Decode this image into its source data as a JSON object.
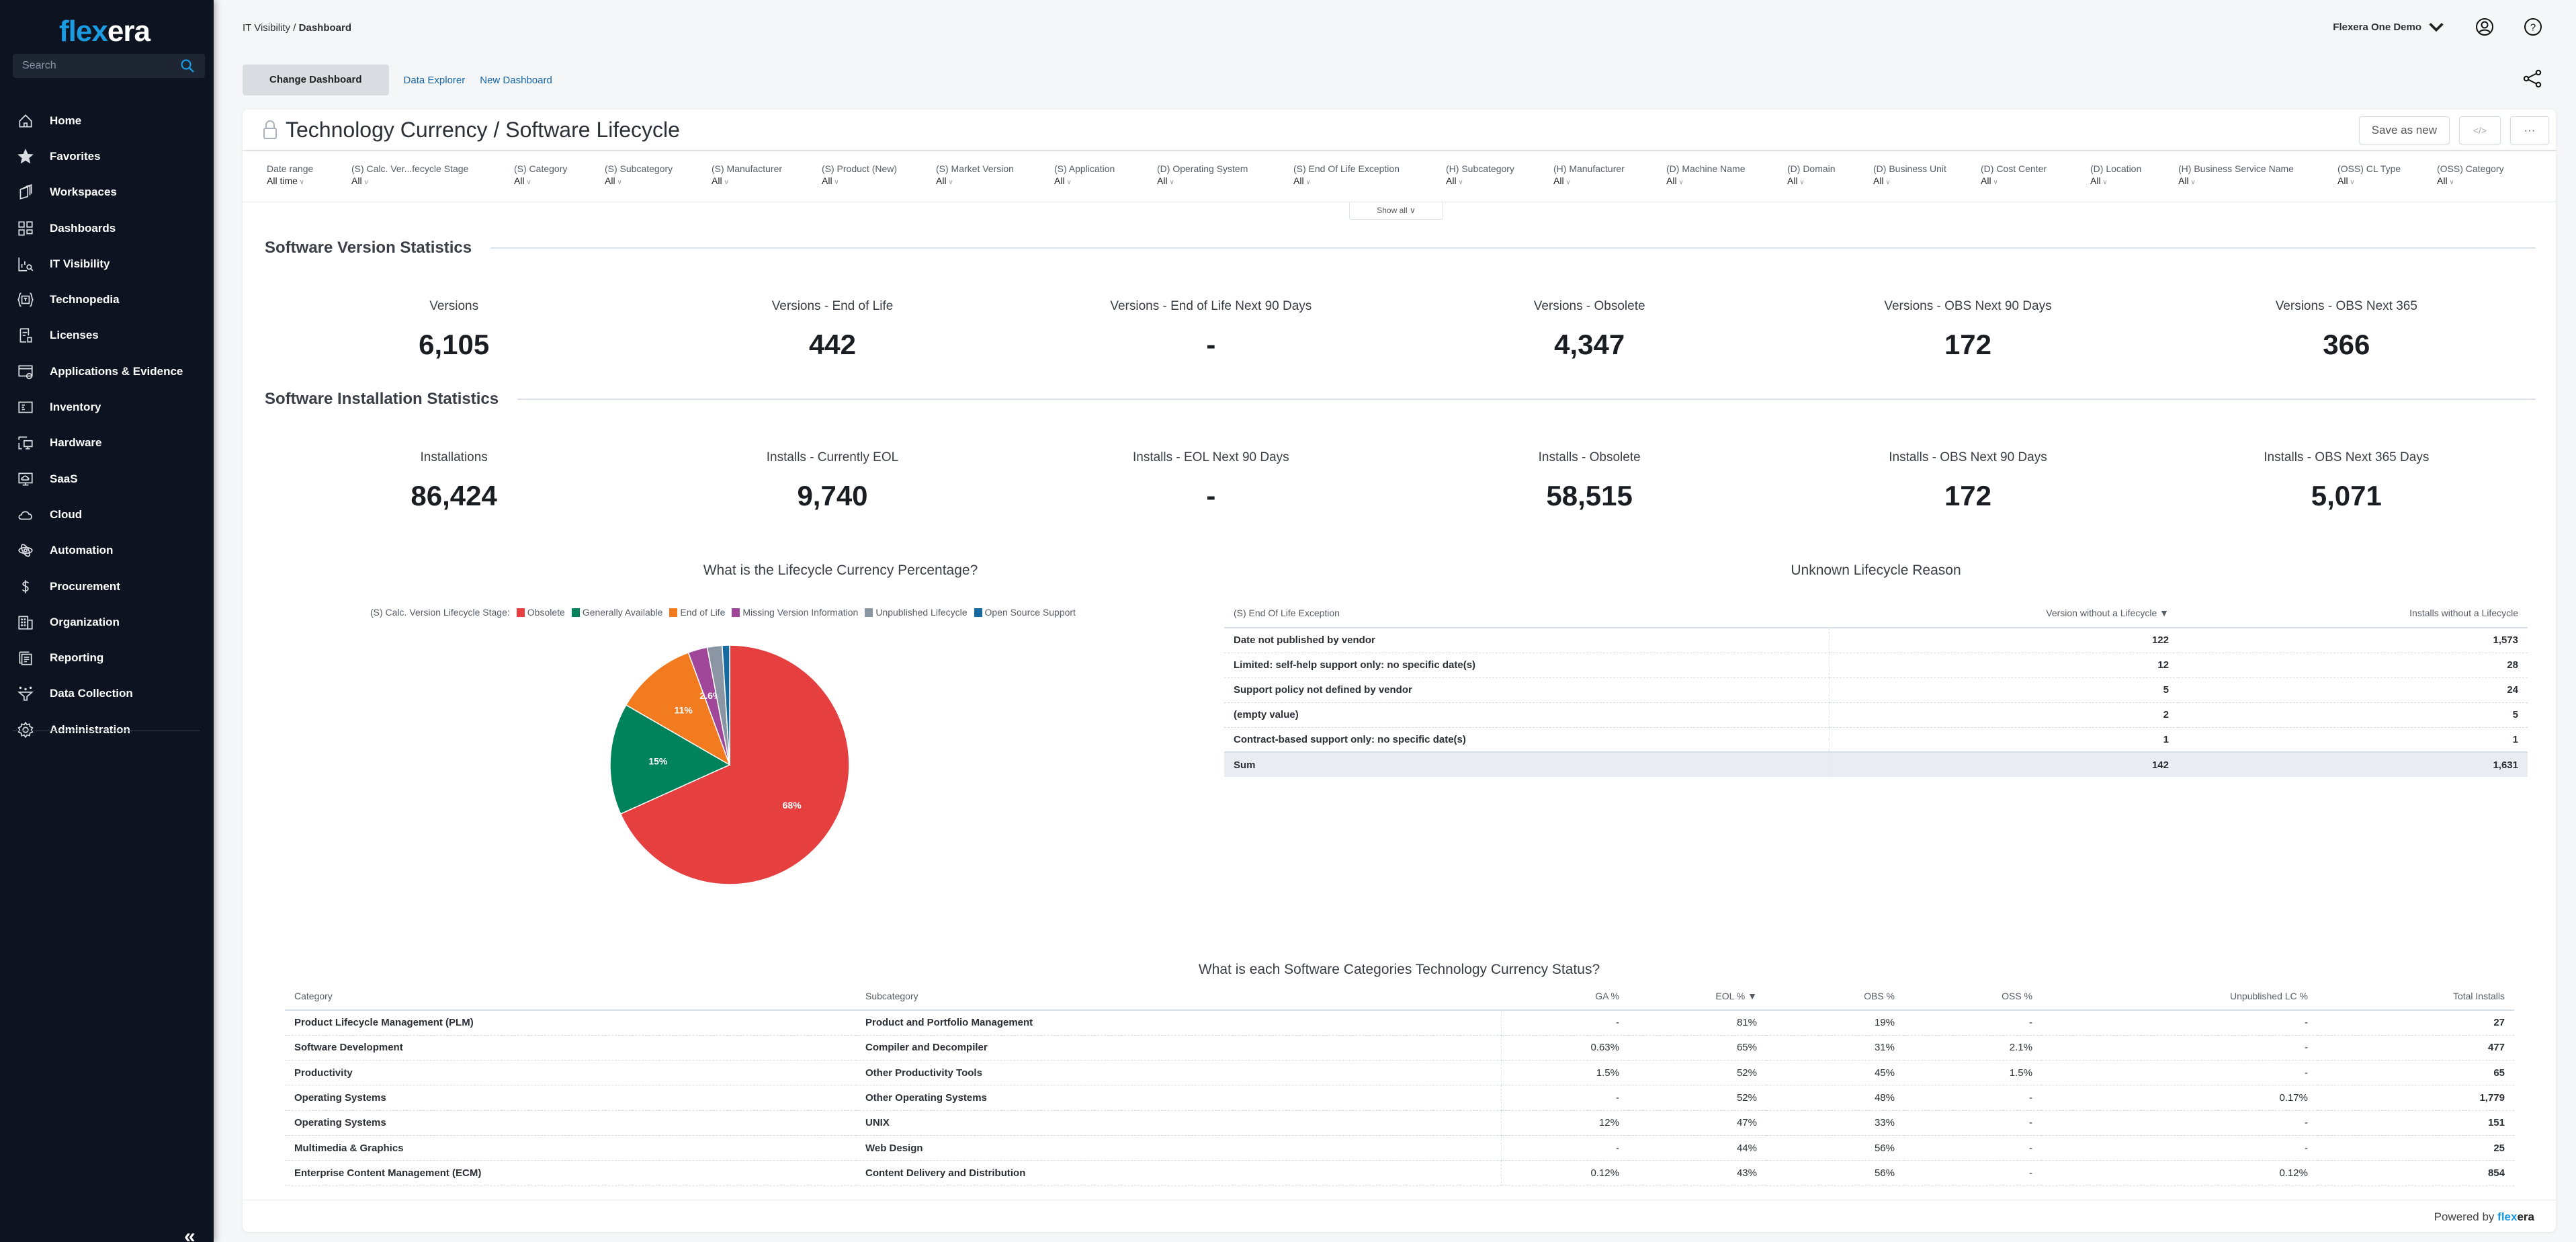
{
  "sidebar": {
    "logo": {
      "part1": "fle",
      "part2": "x",
      "part3": "era"
    },
    "search_placeholder": "Search",
    "items": [
      {
        "label": "Home",
        "icon": "home-icon"
      },
      {
        "label": "Favorites",
        "icon": "star-icon"
      },
      {
        "label": "Workspaces",
        "icon": "workspaces-icon"
      },
      {
        "label": "Dashboards",
        "icon": "dashboards-icon"
      },
      {
        "label": "IT Visibility",
        "icon": "it-visibility-icon"
      },
      {
        "label": "Technopedia",
        "icon": "technopedia-icon"
      },
      {
        "label": "Licenses",
        "icon": "licenses-icon"
      },
      {
        "label": "Applications & Evidence",
        "icon": "applications-icon"
      },
      {
        "label": "Inventory",
        "icon": "inventory-icon"
      },
      {
        "label": "Hardware",
        "icon": "hardware-icon"
      },
      {
        "label": "SaaS",
        "icon": "saas-icon"
      },
      {
        "label": "Cloud",
        "icon": "cloud-icon"
      },
      {
        "label": "Automation",
        "icon": "automation-icon"
      },
      {
        "label": "Procurement",
        "icon": "dollar-icon"
      },
      {
        "label": "Organization",
        "icon": "building-icon"
      },
      {
        "label": "Reporting",
        "icon": "reporting-icon"
      },
      {
        "label": "Data Collection",
        "icon": "funnel-icon"
      },
      {
        "label": "Administration",
        "icon": "gear-icon"
      }
    ],
    "collapse_glyph": "«"
  },
  "header": {
    "breadcrumb_parent": "IT Visibility",
    "breadcrumb_sep": " / ",
    "breadcrumb_current": "Dashboard",
    "account": "Flexera One Demo"
  },
  "toolbar": {
    "change_dashboard": "Change Dashboard",
    "data_explorer": "Data Explorer",
    "new_dashboard": "New Dashboard"
  },
  "dashboard": {
    "title": "Technology Currency / Software Lifecycle",
    "save_as_new": "Save as new",
    "code_glyph": "</>",
    "more_glyph": "···",
    "show_all": "Show all",
    "filters": [
      {
        "label": "Date range",
        "value": "All time"
      },
      {
        "label": "(S) Calc. Ver...fecycle Stage",
        "value": "All"
      },
      {
        "label": "(S) Category",
        "value": "All"
      },
      {
        "label": "(S) Subcategory",
        "value": "All"
      },
      {
        "label": "(S) Manufacturer",
        "value": "All"
      },
      {
        "label": "(S) Product (New)",
        "value": "All"
      },
      {
        "label": "(S) Market Version",
        "value": "All"
      },
      {
        "label": "(S) Application",
        "value": "All"
      },
      {
        "label": "(D) Operating System",
        "value": "All"
      },
      {
        "label": "(S) End Of Life Exception",
        "value": "All"
      },
      {
        "label": "(H) Subcategory",
        "value": "All"
      },
      {
        "label": "(H) Manufacturer",
        "value": "All"
      },
      {
        "label": "(D) Machine Name",
        "value": "All"
      },
      {
        "label": "(D) Domain",
        "value": "All"
      },
      {
        "label": "(D) Business Unit",
        "value": "All"
      },
      {
        "label": "(D) Cost Center",
        "value": "All"
      },
      {
        "label": "(D) Location",
        "value": "All"
      },
      {
        "label": "(H) Business Service Name",
        "value": "All"
      },
      {
        "label": "(OSS) CL Type",
        "value": "All"
      },
      {
        "label": "(OSS) Category",
        "value": "All"
      }
    ]
  },
  "version_stats": {
    "title": "Software Version Statistics",
    "kpis": [
      {
        "label": "Versions",
        "value": "6,105"
      },
      {
        "label": "Versions - End of Life",
        "value": "442"
      },
      {
        "label": "Versions - End of Life Next 90 Days",
        "value": "-"
      },
      {
        "label": "Versions - Obsolete",
        "value": "4,347"
      },
      {
        "label": "Versions - OBS Next 90 Days",
        "value": "172"
      },
      {
        "label": "Versions - OBS Next 365",
        "value": "366"
      }
    ]
  },
  "install_stats": {
    "title": "Software Installation Statistics",
    "kpis": [
      {
        "label": "Installations",
        "value": "86,424"
      },
      {
        "label": "Installs - Currently EOL",
        "value": "9,740"
      },
      {
        "label": "Installs - EOL Next 90 Days",
        "value": "-"
      },
      {
        "label": "Installs - Obsolete",
        "value": "58,515"
      },
      {
        "label": "Installs - OBS Next 90 Days",
        "value": "172"
      },
      {
        "label": "Installs - OBS Next 365 Days",
        "value": "5,071"
      }
    ]
  },
  "chart_data": {
    "type": "pie",
    "title": "What is the Lifecycle Currency Percentage?",
    "legend_title": "(S) Calc. Version Lifecycle Stage:",
    "legend_position": "top",
    "categories": [
      "Obsolete",
      "Generally Available",
      "End of Life",
      "Missing Version Information",
      "Unpublished Lifecycle",
      "Open Source Support"
    ],
    "values": [
      68,
      15,
      11,
      2.6,
      2.0,
      1.0
    ],
    "labels": [
      "68%",
      "15%",
      "11%",
      "2.6%",
      "",
      ""
    ],
    "colors": [
      "#e53f3f",
      "#00825a",
      "#f27a1f",
      "#a0479a",
      "#8a96a3",
      "#156aa0"
    ]
  },
  "unknown_lifecycle": {
    "title": "Unknown Lifecycle Reason",
    "columns": [
      "(S) End Of Life Exception",
      "Version without a Lifecycle",
      "Installs without a Lifecycle"
    ],
    "sort_indicator": "▼",
    "rows": [
      [
        "Date not published by vendor",
        "122",
        "1,573"
      ],
      [
        "Limited: self-help support only: no specific date(s)",
        "12",
        "28"
      ],
      [
        "Support policy not defined by vendor",
        "5",
        "24"
      ],
      [
        "(empty value)",
        "2",
        "5"
      ],
      [
        "Contract-based support only: no specific date(s)",
        "1",
        "1"
      ]
    ],
    "sum": [
      "Sum",
      "142",
      "1,631"
    ]
  },
  "category_status": {
    "title": "What is each Software Categories Technology Currency Status?",
    "columns": [
      "Category",
      "Subcategory",
      "GA %",
      "EOL %",
      "OBS %",
      "OSS %",
      "Unpublished LC %",
      "Total Installs"
    ],
    "sort_indicator": "▼",
    "rows": [
      [
        "Product Lifecycle Management (PLM)",
        "Product and Portfolio Management",
        "-",
        "81%",
        "19%",
        "-",
        "-",
        "27"
      ],
      [
        "Software Development",
        "Compiler and Decompiler",
        "0.63%",
        "65%",
        "31%",
        "2.1%",
        "-",
        "477"
      ],
      [
        "Productivity",
        "Other Productivity Tools",
        "1.5%",
        "52%",
        "45%",
        "1.5%",
        "-",
        "65"
      ],
      [
        "Operating Systems",
        "Other Operating Systems",
        "-",
        "52%",
        "48%",
        "-",
        "0.17%",
        "1,779"
      ],
      [
        "Operating Systems",
        "UNIX",
        "12%",
        "47%",
        "33%",
        "-",
        "-",
        "151"
      ],
      [
        "Multimedia & Graphics",
        "Web Design",
        "-",
        "44%",
        "56%",
        "-",
        "-",
        "25"
      ],
      [
        "Enterprise Content Management (ECM)",
        "Content Delivery and Distribution",
        "0.12%",
        "43%",
        "56%",
        "-",
        "0.12%",
        "854"
      ]
    ]
  },
  "footer": {
    "powered_by": "Powered by",
    "brand1": "fle",
    "brand2": "x",
    "brand3": "era"
  }
}
